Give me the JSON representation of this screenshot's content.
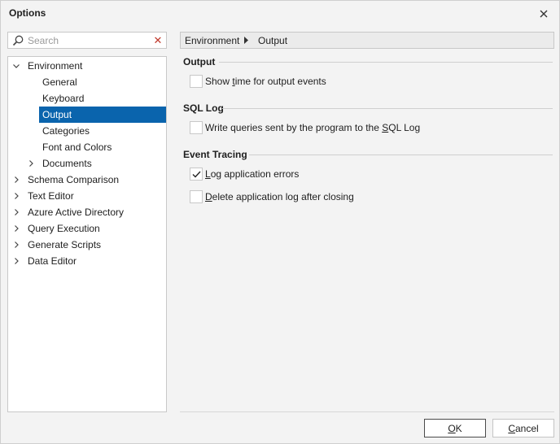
{
  "window": {
    "title": "Options"
  },
  "search": {
    "placeholder": "Search",
    "value": ""
  },
  "tree": {
    "items": [
      {
        "label": "Environment",
        "level": 0,
        "state": "expanded"
      },
      {
        "label": "General",
        "level": 1,
        "state": "leaf"
      },
      {
        "label": "Keyboard",
        "level": 1,
        "state": "leaf"
      },
      {
        "label": "Output",
        "level": 1,
        "state": "leaf",
        "selected": true
      },
      {
        "label": "Categories",
        "level": 1,
        "state": "leaf"
      },
      {
        "label": "Font and Colors",
        "level": 1,
        "state": "leaf"
      },
      {
        "label": "Documents",
        "level": 1,
        "state": "collapsed"
      },
      {
        "label": "Schema Comparison",
        "level": 0,
        "state": "collapsed"
      },
      {
        "label": "Text Editor",
        "level": 0,
        "state": "collapsed"
      },
      {
        "label": "Azure Active Directory",
        "level": 0,
        "state": "collapsed"
      },
      {
        "label": "Query Execution",
        "level": 0,
        "state": "collapsed"
      },
      {
        "label": "Generate Scripts",
        "level": 0,
        "state": "collapsed"
      },
      {
        "label": "Data Editor",
        "level": 0,
        "state": "collapsed"
      }
    ]
  },
  "breadcrumb": {
    "parent": "Environment",
    "current": "Output"
  },
  "groups": {
    "output": {
      "header": "Output",
      "show_time": {
        "pre": "Show ",
        "key": "t",
        "post": "ime for output events",
        "checked": false
      }
    },
    "sql_log": {
      "header": "SQL Log",
      "write_queries": {
        "pre": "Write queries sent by the program to the ",
        "key": "S",
        "post": "QL Log",
        "checked": false
      }
    },
    "event_tracing": {
      "header": "Event Tracing",
      "log_errors": {
        "pre": "",
        "key": "L",
        "post": "og application errors",
        "checked": true
      },
      "delete_log": {
        "pre": "",
        "key": "D",
        "post": "elete application log after closing",
        "checked": false
      }
    }
  },
  "buttons": {
    "ok": {
      "key": "O",
      "post": "K"
    },
    "cancel": {
      "key": "C",
      "post": "ancel"
    }
  },
  "colors": {
    "selection": "#0a64ad",
    "clear_icon": "#c0392b"
  }
}
